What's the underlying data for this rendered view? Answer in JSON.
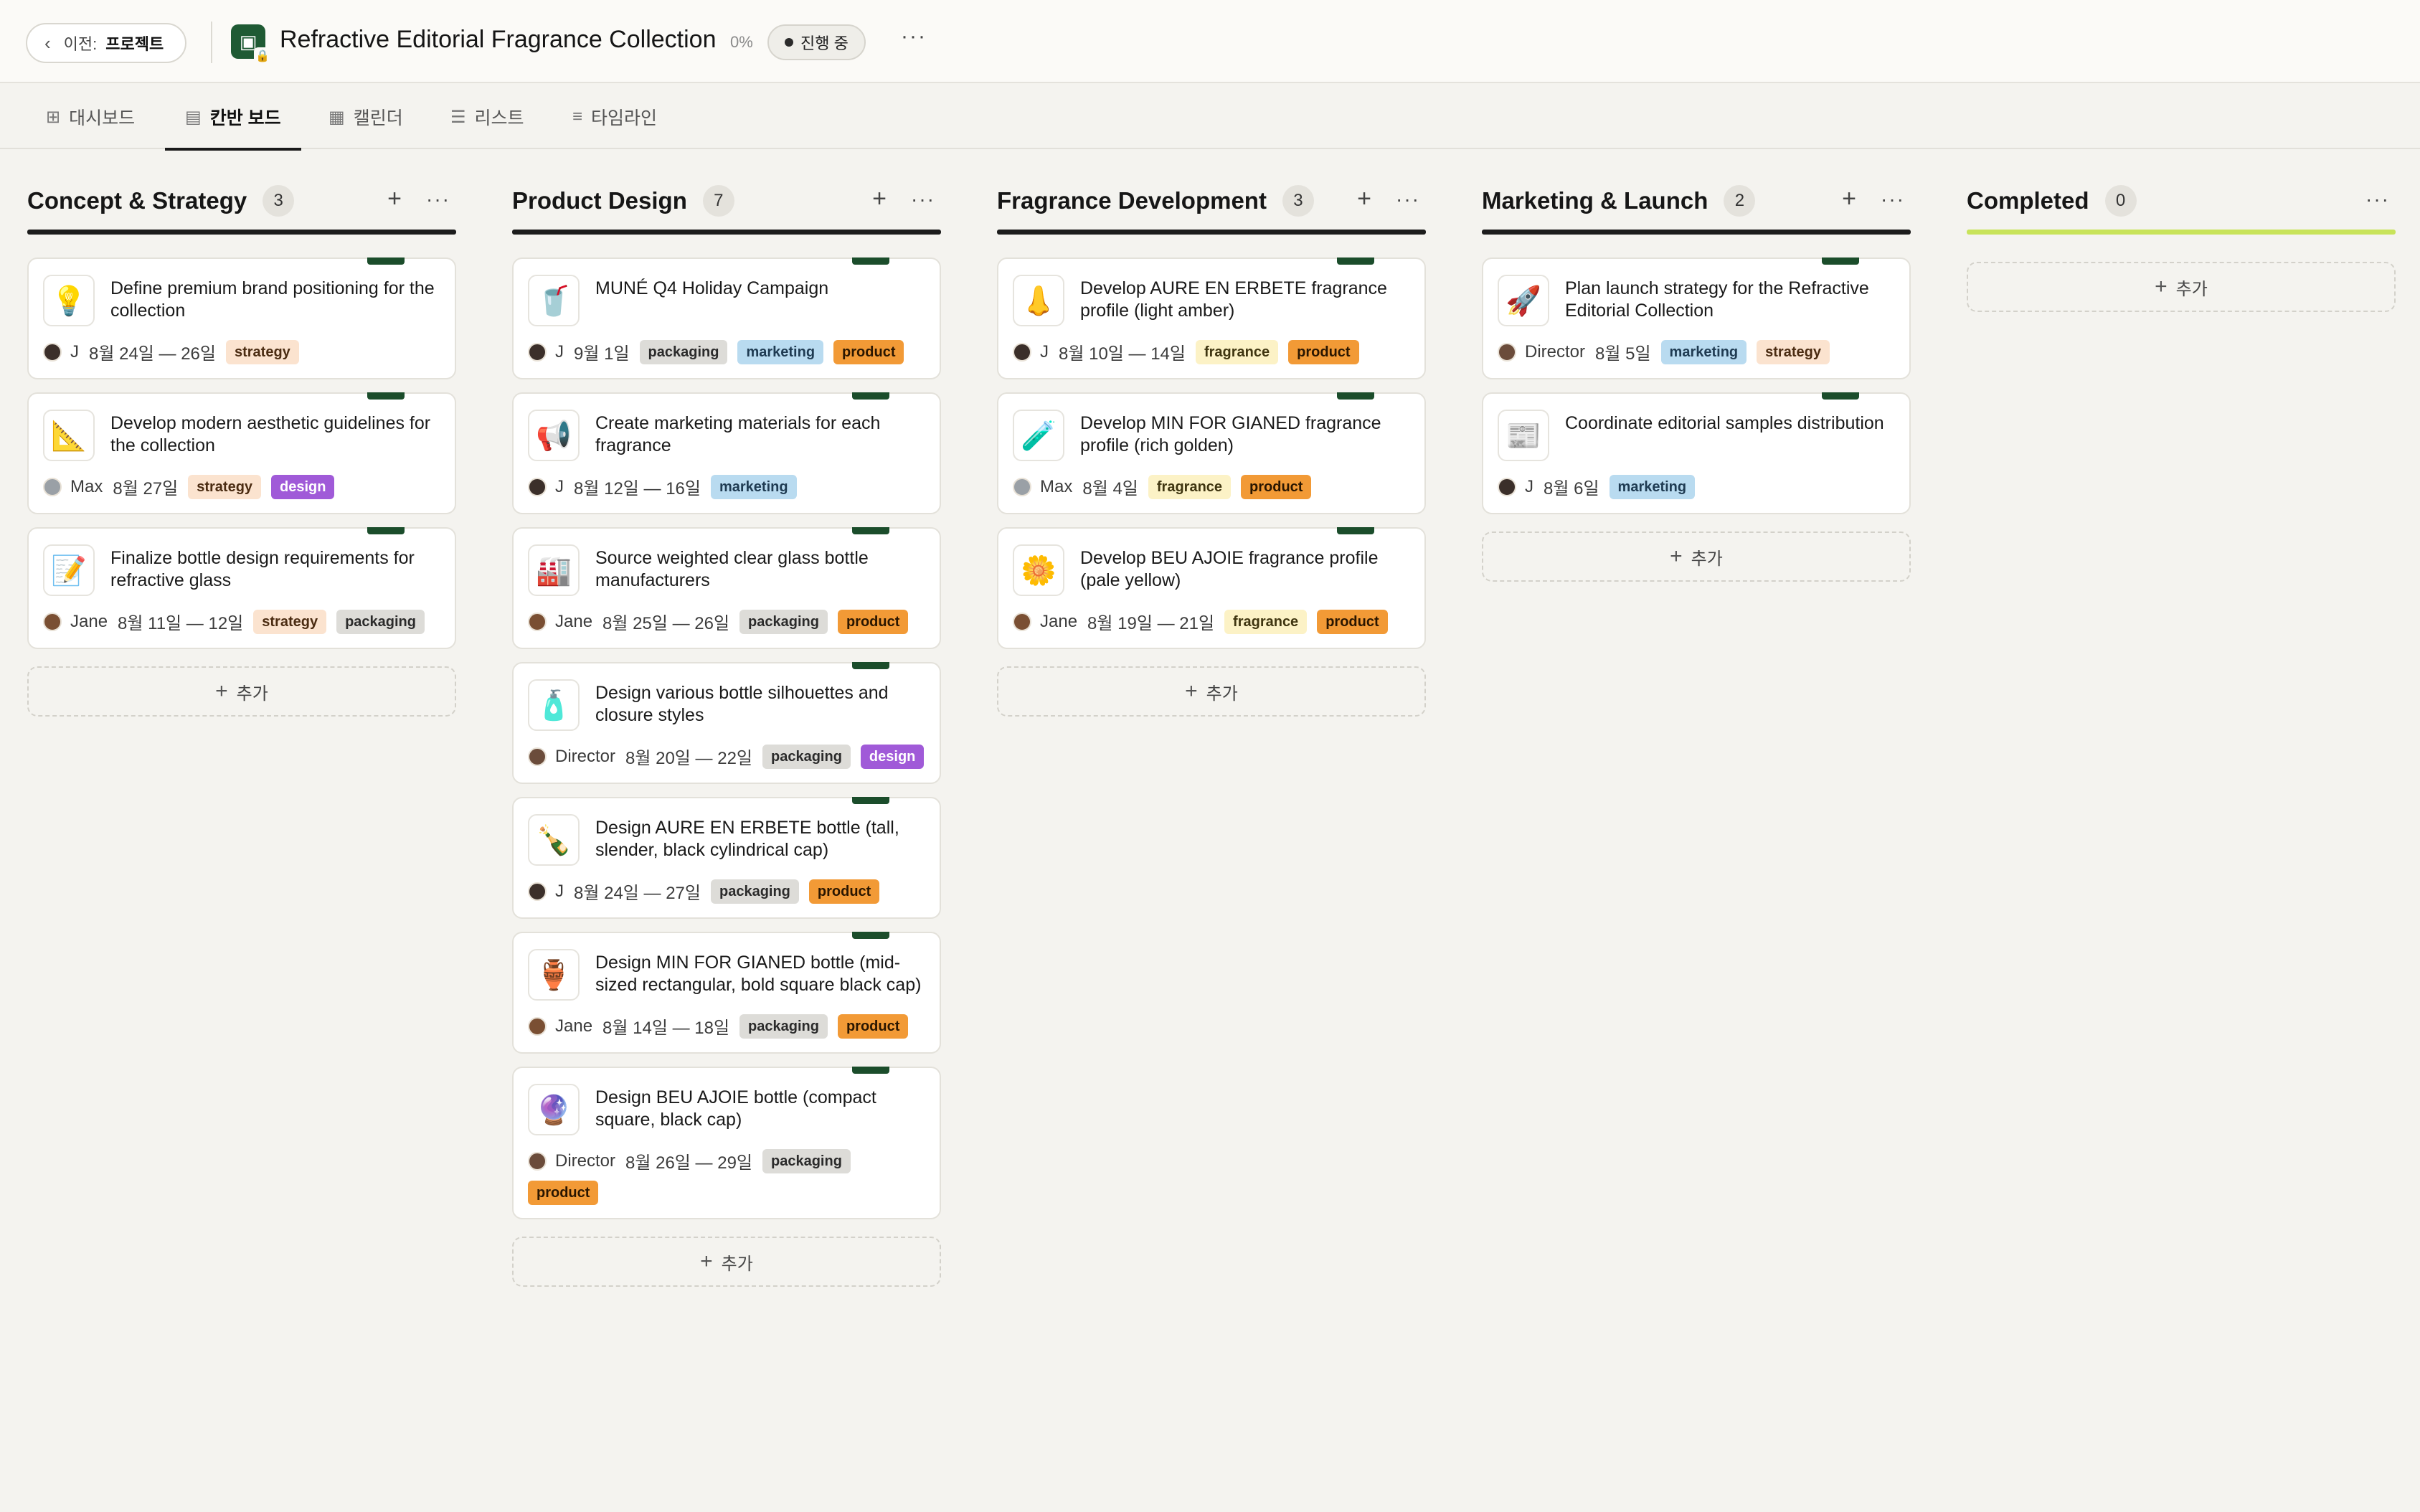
{
  "header": {
    "back_label": "이전:",
    "back_crumb": "프로젝트",
    "project_title": "Refractive Editorial Fragrance Collection",
    "progress_text": "0%",
    "status_label": "진행 중",
    "more_icon": "ellipsis-icon"
  },
  "tabs": [
    {
      "label": "대시보드",
      "icon": "grid-icon",
      "active": false
    },
    {
      "label": "칸반 보드",
      "icon": "kanban-icon",
      "active": true
    },
    {
      "label": "캘린더",
      "icon": "calendar-icon",
      "active": false
    },
    {
      "label": "리스트",
      "icon": "list-icon",
      "active": false
    },
    {
      "label": "타임라인",
      "icon": "timeline-icon",
      "active": false
    }
  ],
  "add_label": "추가",
  "columns": [
    {
      "title": "Concept & Strategy",
      "count": "3",
      "cards": [
        {
          "emoji": "💡",
          "title": "Define premium brand positioning for the collection",
          "assignee": "J",
          "date": "8월 24일 — 26일",
          "tags": [
            "strategy"
          ]
        },
        {
          "emoji": "📐",
          "title": "Develop modern aesthetic guidelines for the collection",
          "assignee": "Max",
          "date": "8월 27일",
          "tags": [
            "strategy",
            "design"
          ]
        },
        {
          "emoji": "📝",
          "title": "Finalize bottle design requirements for refractive glass",
          "assignee": "Jane",
          "date": "8월 11일 — 12일",
          "tags": [
            "strategy",
            "packaging"
          ]
        }
      ]
    },
    {
      "title": "Product Design",
      "count": "7",
      "cards": [
        {
          "emoji": "🥤",
          "title": "MUNÉ Q4 Holiday Campaign",
          "assignee": "J",
          "date": "9월 1일",
          "tags": [
            "packaging",
            "marketing",
            "product"
          ]
        },
        {
          "emoji": "📢",
          "title": "Create marketing materials for each fragrance",
          "assignee": "J",
          "date": "8월 12일 — 16일",
          "tags": [
            "marketing"
          ]
        },
        {
          "emoji": "🏭",
          "title": "Source weighted clear glass bottle manufacturers",
          "assignee": "Jane",
          "date": "8월 25일 — 26일",
          "tags": [
            "packaging",
            "product"
          ]
        },
        {
          "emoji": "🧴",
          "title": "Design various bottle silhouettes and closure styles",
          "assignee": "Director",
          "date": "8월 20일 — 22일",
          "tags": [
            "packaging",
            "design"
          ]
        },
        {
          "emoji": "🍾",
          "title": "Design AURE EN ERBETE bottle (tall, slender, black cylindrical cap)",
          "assignee": "J",
          "date": "8월 24일 — 27일",
          "tags": [
            "packaging",
            "product"
          ]
        },
        {
          "emoji": "🏺",
          "title": "Design MIN FOR GIANED bottle (mid-sized rectangular, bold square black cap)",
          "assignee": "Jane",
          "date": "8월 14일 — 18일",
          "tags": [
            "packaging",
            "product"
          ]
        },
        {
          "emoji": "🔮",
          "title": "Design BEU AJOIE bottle (compact square, black cap)",
          "assignee": "Director",
          "date": "8월 26일 — 29일",
          "tags": [
            "packaging",
            "product"
          ]
        }
      ]
    },
    {
      "title": "Fragrance Development",
      "count": "3",
      "cards": [
        {
          "emoji": "👃",
          "title": "Develop AURE EN ERBETE fragrance profile (light amber)",
          "assignee": "J",
          "date": "8월 10일 — 14일",
          "tags": [
            "fragrance",
            "product"
          ]
        },
        {
          "emoji": "🧪",
          "title": "Develop MIN FOR GIANED fragrance profile (rich golden)",
          "assignee": "Max",
          "date": "8월 4일",
          "tags": [
            "fragrance",
            "product"
          ]
        },
        {
          "emoji": "🌼",
          "title": "Develop BEU AJOIE fragrance profile (pale yellow)",
          "assignee": "Jane",
          "date": "8월 19일 — 21일",
          "tags": [
            "fragrance",
            "product"
          ]
        }
      ]
    },
    {
      "title": "Marketing & Launch",
      "count": "2",
      "cards": [
        {
          "emoji": "🚀",
          "title": "Plan launch strategy for the Refractive Editorial Collection",
          "assignee": "Director",
          "date": "8월 5일",
          "tags": [
            "marketing",
            "strategy"
          ]
        },
        {
          "emoji": "📰",
          "title": "Coordinate editorial samples distribution",
          "assignee": "J",
          "date": "8월 6일",
          "tags": [
            "marketing"
          ]
        }
      ]
    },
    {
      "title": "Completed",
      "count": "0",
      "cards": []
    }
  ]
}
